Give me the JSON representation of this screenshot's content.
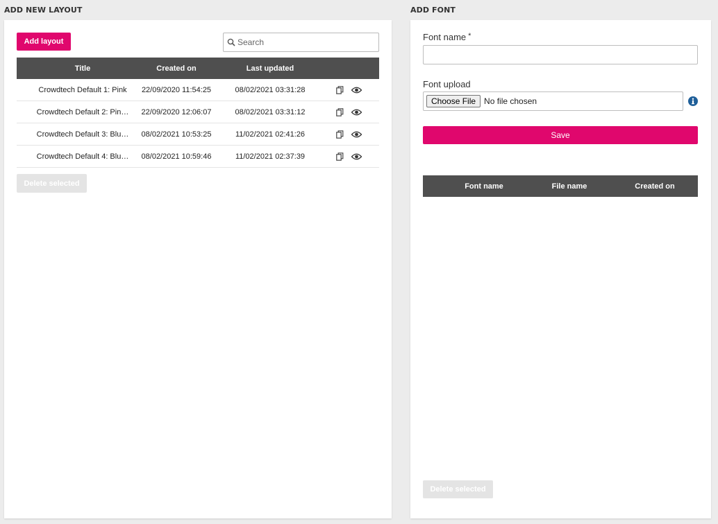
{
  "layouts_section": {
    "title": "ADD NEW LAYOUT",
    "add_button": "Add layout",
    "search_placeholder": "Search",
    "columns": [
      "Title",
      "Created on",
      "Last updated"
    ],
    "rows": [
      {
        "title": "Crowdtech Default 1: Pink",
        "created": "22/09/2020 11:54:25",
        "updated": "08/02/2021 03:31:28"
      },
      {
        "title": "Crowdtech Default 2: Pin…",
        "created": "22/09/2020 12:06:07",
        "updated": "08/02/2021 03:31:12"
      },
      {
        "title": "Crowdtech Default 3: Blu…",
        "created": "08/02/2021 10:53:25",
        "updated": "11/02/2021 02:41:26"
      },
      {
        "title": "Crowdtech Default 4: Blu…",
        "created": "08/02/2021 10:59:46",
        "updated": "11/02/2021 02:37:39"
      }
    ],
    "row_actions": [
      "copy-icon",
      "eye-icon"
    ],
    "delete_button": "Delete selected"
  },
  "font_section": {
    "title": "ADD FONT",
    "font_name_label": "Font name",
    "required_mark": "*",
    "font_upload_label": "Font upload",
    "choose_file_button": "Choose File",
    "file_status": "No file chosen",
    "info_icon": "info-icon",
    "save_button": "Save",
    "columns": [
      "Font name",
      "File name",
      "Created on"
    ],
    "delete_button": "Delete selected"
  },
  "colors": {
    "accent": "#e0076d",
    "table_header": "#4f4f4f",
    "info_icon": "#1f5f99",
    "background": "#ececec"
  }
}
